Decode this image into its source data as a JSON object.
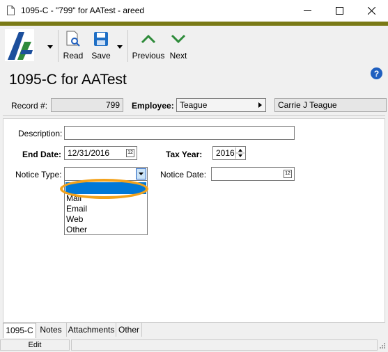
{
  "window": {
    "title": "1095-C - \"799\" for AATest - areed"
  },
  "toolbar": {
    "read_label": "Read",
    "save_label": "Save",
    "previous_label": "Previous",
    "next_label": "Next"
  },
  "page": {
    "title": "1095-C for AATest"
  },
  "record": {
    "label": "Record #:",
    "value": "799"
  },
  "employee": {
    "label": "Employee:",
    "id_value": "Teague",
    "name_value": "Carrie J Teague"
  },
  "form": {
    "description_label": "Description:",
    "description_value": "",
    "end_date_label": "End Date:",
    "end_date_value": "12/31/2016",
    "tax_year_label": "Tax Year:",
    "tax_year_value": "2016",
    "notice_type_label": "Notice Type:",
    "notice_type_value": "",
    "notice_date_label": "Notice Date:",
    "notice_date_value": ""
  },
  "dropdown": {
    "options": [
      "",
      "Mail",
      "Email",
      "Web",
      "Other"
    ],
    "highlighted_index": 0
  },
  "tabs": [
    "1095-C",
    "Notes",
    "Attachments",
    "Other"
  ],
  "status": {
    "mode": "Edit"
  },
  "colors": {
    "accent_bar": "#7a7a16",
    "selection": "#0078d7",
    "annotation": "#f3a21b",
    "nav_arrow": "#2e8b3a"
  }
}
